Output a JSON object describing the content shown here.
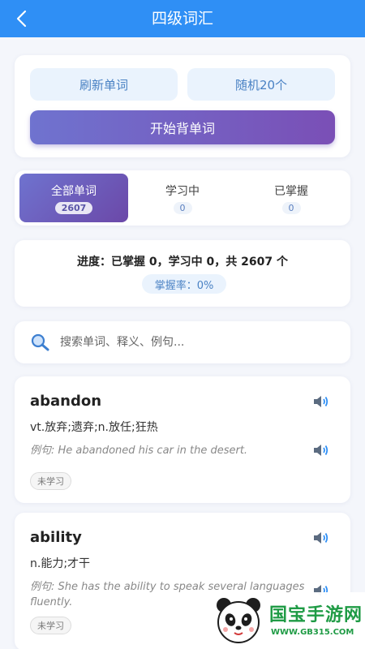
{
  "header": {
    "title": "四级词汇"
  },
  "actions": {
    "refresh_label": "刷新单词",
    "random_label": "随机20个",
    "start_label": "开始背单词"
  },
  "tabs": [
    {
      "label": "全部单词",
      "count": "2607"
    },
    {
      "label": "学习中",
      "count": "0"
    },
    {
      "label": "已掌握",
      "count": "0"
    }
  ],
  "progress": {
    "summary": "进度：已掌握 0，学习中 0，共 2607 个",
    "rate": "掌握率：0%"
  },
  "search": {
    "placeholder": "搜索单词、释义、例句..."
  },
  "words": [
    {
      "word": "abandon",
      "meaning": "vt.放弃;遗弃;n.放任;狂热",
      "example": "例句: He abandoned his car in the desert.",
      "status": "未学习"
    },
    {
      "word": "ability",
      "meaning": "n.能力;才干",
      "example": "例句: She has the ability to speak several languages fluently.",
      "status": "未学习"
    }
  ],
  "watermark": {
    "text": "国宝手游网",
    "sub": "WWW.GB315.COM"
  },
  "colors": {
    "header": "#2f8ff5",
    "accent_gradient_start": "#6f73cf",
    "accent_gradient_end": "#7a4fb6",
    "soft_button": "#eaf3fd",
    "watermark": "#1f9b45"
  },
  "icons": {
    "back": "chevron-left-icon",
    "search": "search-icon",
    "speaker": "speaker-icon",
    "logo": "panda-logo"
  }
}
